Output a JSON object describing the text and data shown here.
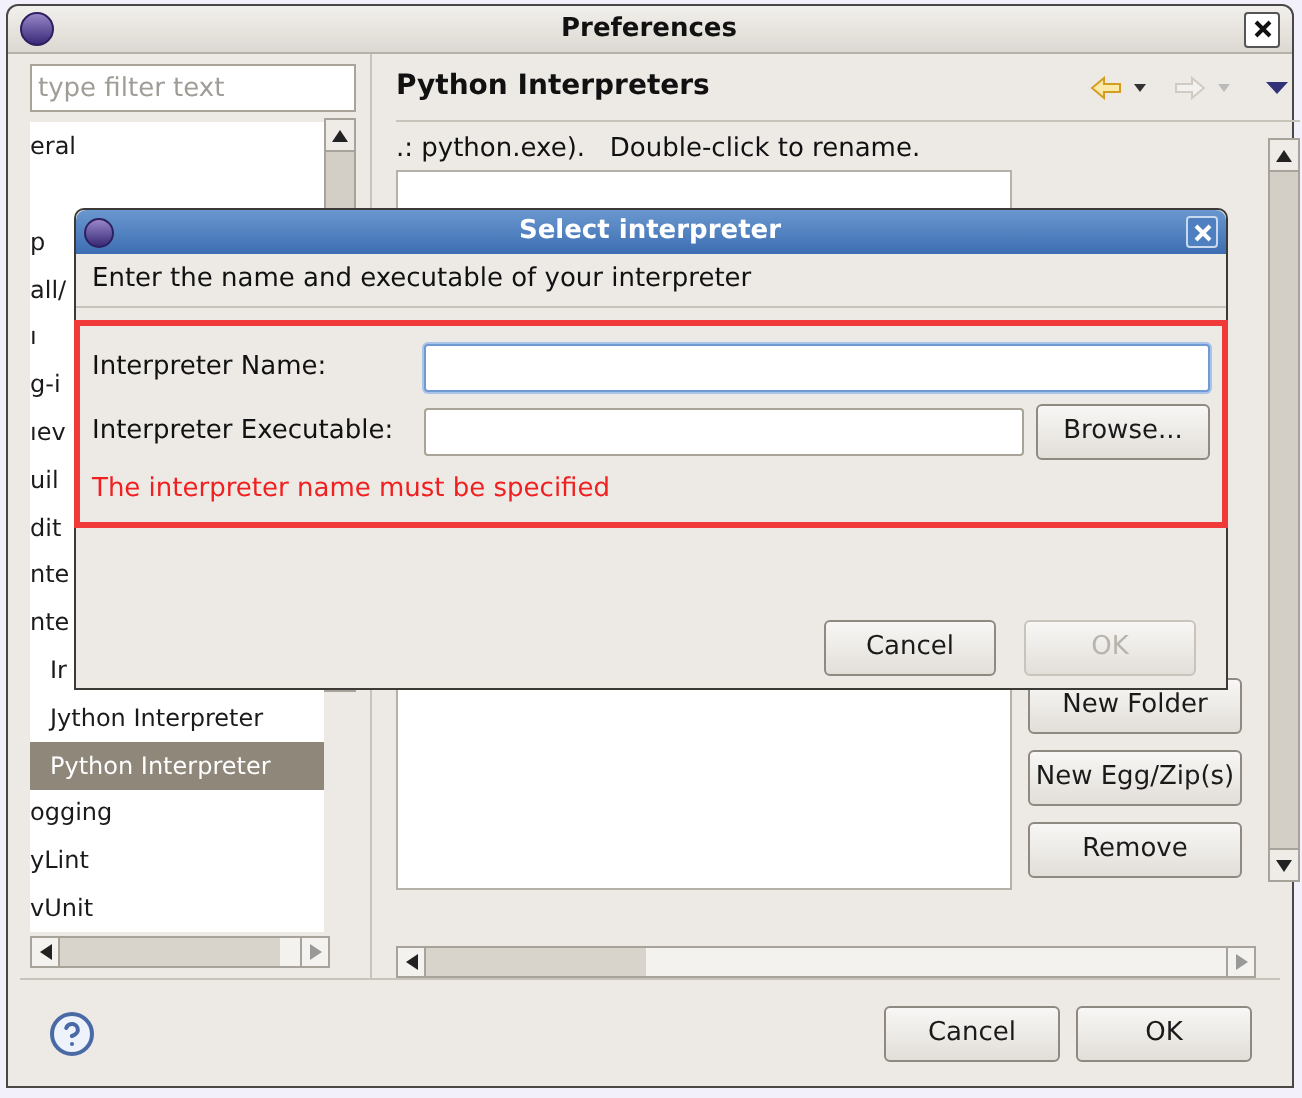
{
  "window": {
    "title": "Preferences"
  },
  "filter": {
    "placeholder": "type filter text"
  },
  "tree": [
    {
      "label": "eral",
      "selected": false
    },
    {
      "label": "p",
      "selected": false
    },
    {
      "label": "all/",
      "selected": false
    },
    {
      "label": "ı",
      "selected": false
    },
    {
      "label": "g-i",
      "selected": false
    },
    {
      "label": "ıev",
      "selected": false
    },
    {
      "label": "uil",
      "selected": false
    },
    {
      "label": "dit",
      "selected": false
    },
    {
      "label": "nte",
      "selected": false
    },
    {
      "label": "nte",
      "selected": false,
      "children": [
        {
          "label": "Ir",
          "selected": false
        },
        {
          "label": "Jython Interpreter",
          "selected": false
        },
        {
          "label": "Python Interpreter",
          "selected": true
        }
      ]
    },
    {
      "label": "ogging",
      "selected": false
    },
    {
      "label": "yLint",
      "selected": false
    },
    {
      "label": "vUnit",
      "selected": false
    }
  ],
  "page": {
    "title": "Python Interpreters",
    "description": ".: python.exe).   Double-click to rename.",
    "buttons": [
      "New Folder",
      "New Egg/Zip(s)",
      "Remove"
    ]
  },
  "footer": {
    "buttons": [
      {
        "label": "Cancel"
      },
      {
        "label": "OK"
      }
    ]
  },
  "dialog": {
    "title": "Select interpreter",
    "message": "Enter the name and executable of your interpreter",
    "fields": [
      {
        "label": "Interpreter Name:",
        "focused": true
      },
      {
        "label": "Interpreter Executable:",
        "focused": false,
        "button": "Browse..."
      }
    ],
    "error": "The interpreter name must be specified",
    "buttons": [
      {
        "label": "Cancel",
        "disabled": false
      },
      {
        "label": "OK",
        "disabled": true
      }
    ]
  }
}
